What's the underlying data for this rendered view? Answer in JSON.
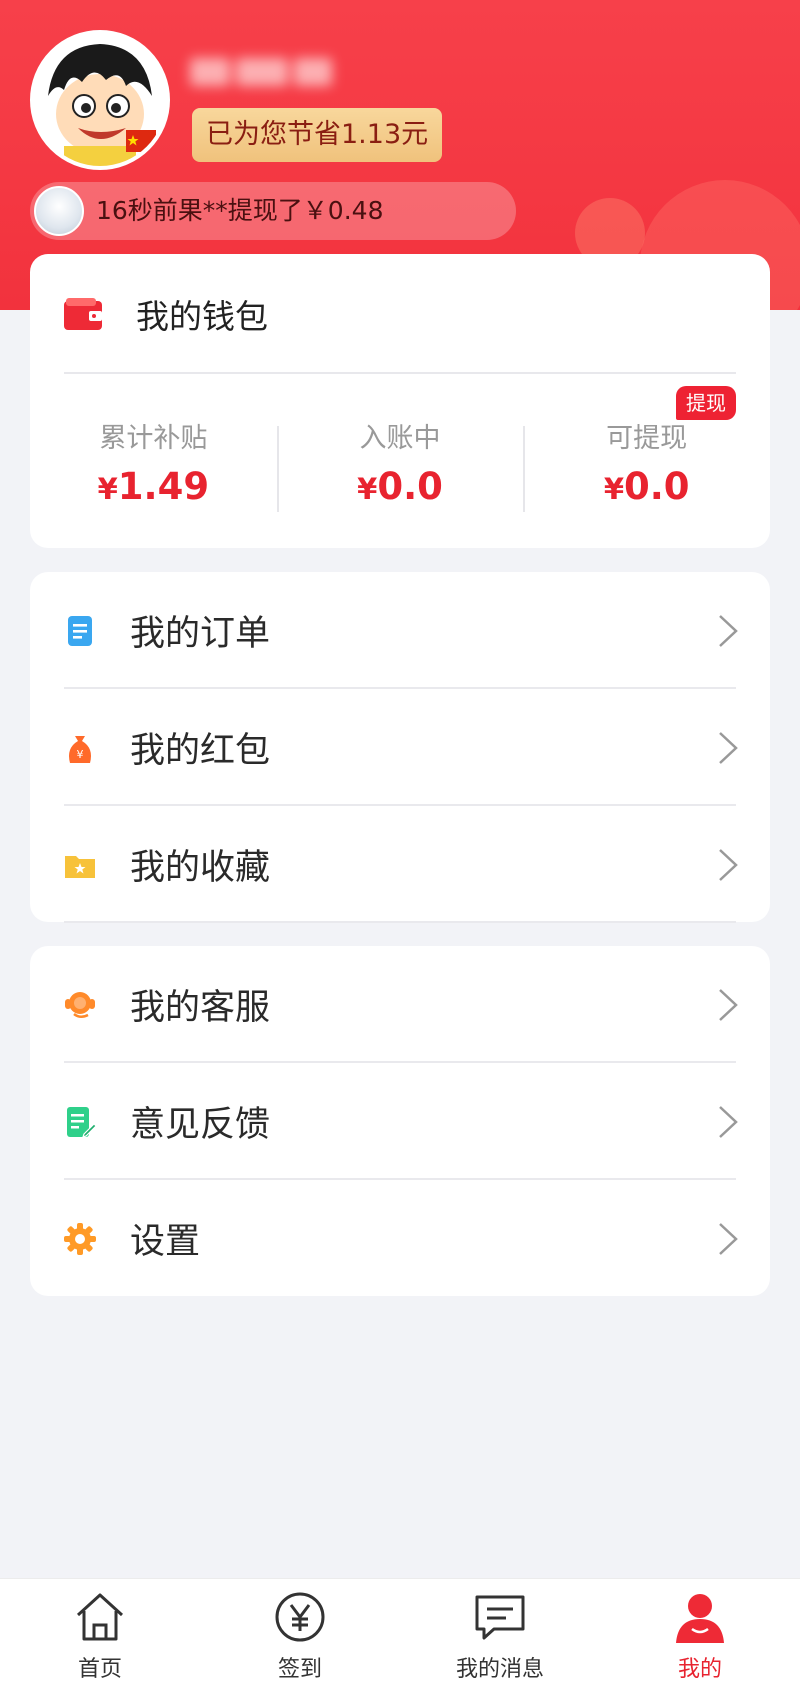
{
  "header": {
    "saved_text": "已为您节省1.13元",
    "ticker_text": "16秒前果**提现了￥0.48"
  },
  "wallet": {
    "title": "我的钱包",
    "withdraw_tag": "提现",
    "stats": [
      {
        "label": "累计补贴",
        "currency": "¥",
        "amount": "1.49"
      },
      {
        "label": "入账中",
        "currency": "¥",
        "amount": "0.0"
      },
      {
        "label": "可提现",
        "currency": "¥",
        "amount": "0.0"
      }
    ]
  },
  "menu": {
    "group1": [
      {
        "label": "我的订单",
        "icon": "order-icon"
      },
      {
        "label": "我的红包",
        "icon": "red-packet-icon"
      },
      {
        "label": "我的收藏",
        "icon": "favorites-icon"
      }
    ],
    "group2": [
      {
        "label": "我的客服",
        "icon": "customer-service-icon"
      },
      {
        "label": "意见反馈",
        "icon": "feedback-icon"
      },
      {
        "label": "设置",
        "icon": "settings-icon"
      }
    ]
  },
  "tabbar": {
    "tabs": [
      {
        "label": "首页",
        "icon": "home-icon"
      },
      {
        "label": "签到",
        "icon": "yen-icon"
      },
      {
        "label": "我的消息",
        "icon": "message-icon"
      },
      {
        "label": "我的",
        "icon": "user-icon",
        "active": true
      }
    ]
  },
  "colors": {
    "brand_red": "#f2323d",
    "price_red": "#e8232f",
    "badge_gold": "#f0c27c"
  }
}
